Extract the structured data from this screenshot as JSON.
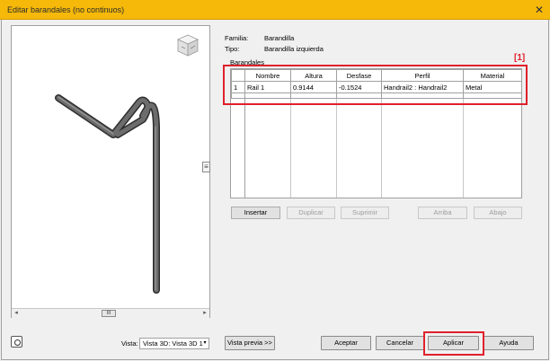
{
  "window": {
    "title": "Editar barandales (no continuos)",
    "close_glyph": "✕",
    "accent_color": "#f6b90a"
  },
  "preview": {
    "viewcube_icon": "viewcube-icon",
    "scroll_glyph": "≡",
    "hscroll_left": "◂",
    "hscroll_right": "▸",
    "hscroll_thumb": "III",
    "rail_color": "#555555"
  },
  "properties": {
    "familia_label": "Familia:",
    "familia_value": "Barandilla",
    "tipo_label": "Tipo:",
    "tipo_value": "Barandilla izquierda",
    "section_label": "Barandales"
  },
  "table": {
    "headers": [
      "",
      "Nombre",
      "Altura",
      "Desfase",
      "Perfil",
      "Material"
    ],
    "rows": [
      {
        "index": "1",
        "nombre": "Rail 1",
        "altura": "0.9144",
        "desfase": "-0.1524",
        "perfil": "Handrail2 : Handrail2",
        "material": "Metal"
      }
    ]
  },
  "table_buttons": {
    "insertar": "Insertar",
    "duplicar": "Duplicar",
    "suprimir": "Suprimir",
    "arriba": "Arriba",
    "abajo": "Abajo"
  },
  "footer": {
    "vista_label": "Vista:",
    "vista_value": "Vista 3D: Vista 3D 1",
    "vista_arrow": "▾",
    "vista_previa": "Vista previa >>",
    "aceptar": "Aceptar",
    "cancelar": "Cancelar",
    "aplicar": "Aplicar",
    "ayuda": "Ayuda"
  },
  "annotation": {
    "label": "[1]",
    "color": "#e0202c"
  }
}
